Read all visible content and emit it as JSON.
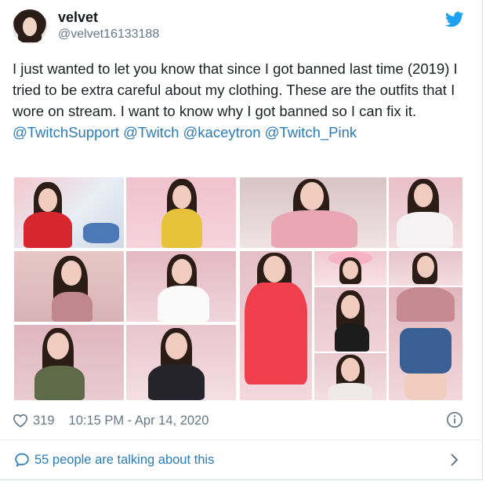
{
  "author": {
    "name": "velvet",
    "handle": "@velvet16133188"
  },
  "tweet": {
    "text_before_mentions": "I just wanted to let you know that since I got banned last time (2019) I tried to be extra careful about my clothing. These are the outfits that I wore on stream. I want to know why I got banned so I can fix it.",
    "mentions": [
      "@TwitchSupport",
      "@Twitch",
      "@kaceytron",
      "@Twitch_Pink"
    ]
  },
  "stats": {
    "likes": "319",
    "timestamp": "10:15 PM - Apr 14, 2020"
  },
  "conversation": {
    "label": "55 people are talking about this"
  },
  "icons": {
    "brand": "twitter-bird-icon",
    "like": "heart-icon",
    "info": "info-icon",
    "reply": "speech-bubble-icon",
    "more": "chevron-right-icon"
  },
  "colors": {
    "link": "#2b7bb9",
    "brand": "#1da1f2",
    "muted": "#657786"
  }
}
